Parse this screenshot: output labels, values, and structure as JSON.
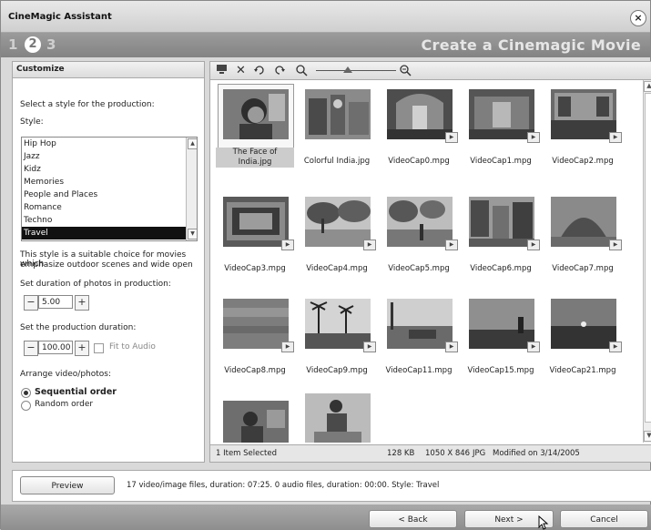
{
  "window": {
    "title": "CineMagic Assistant",
    "close_glyph": "×"
  },
  "steps": {
    "items": [
      "1",
      "2",
      "3"
    ],
    "active": "2",
    "heading": "Create a Cinemagic Movie"
  },
  "customize": {
    "header": "Customize",
    "select_prompt": "Select a style for the production:",
    "style_label": "Style:",
    "styles": [
      "Hip Hop",
      "Jazz",
      "Kidz",
      "Memories",
      "People and Places",
      "Romance",
      "Techno",
      "Travel"
    ],
    "selected_style": "Travel",
    "description_line1": "This style is a suitable choice for movies which",
    "description_line2": "emphasize outdoor scenes and wide open",
    "photo_duration_label": "Set duration of photos in production:",
    "photo_duration_value": "5.00",
    "production_duration_label": "Set the production duration:",
    "production_duration_value": "100.00",
    "fit_to_audio_label": "Fit to Audio",
    "arrange_label": "Arrange video/photos:",
    "sequential_label": "Sequential order",
    "random_label": "Random order",
    "minus": "−",
    "plus": "+"
  },
  "toolbar": {
    "icons": [
      "monitor-icon",
      "delete-icon",
      "rotate-left-icon",
      "rotate-right-icon",
      "zoom-out-icon",
      "zoom-in-icon"
    ]
  },
  "media": {
    "items": [
      {
        "name": "The Face of India.jpg",
        "line1": "The Face of",
        "line2": "India.jpg",
        "type": "photo",
        "selected": true
      },
      {
        "name": "Colorful India.jpg",
        "type": "photo"
      },
      {
        "name": "VideoCap0.mpg",
        "type": "video"
      },
      {
        "name": "VideoCap1.mpg",
        "type": "video"
      },
      {
        "name": "VideoCap2.mpg",
        "type": "video"
      },
      {
        "name": "VideoCap3.mpg",
        "type": "video"
      },
      {
        "name": "VideoCap4.mpg",
        "type": "video"
      },
      {
        "name": "VideoCap5.mpg",
        "type": "video"
      },
      {
        "name": "VideoCap6.mpg",
        "type": "video"
      },
      {
        "name": "VideoCap7.mpg",
        "type": "video"
      },
      {
        "name": "VideoCap8.mpg",
        "type": "video"
      },
      {
        "name": "VideoCap9.mpg",
        "type": "video"
      },
      {
        "name": "VideoCap11.mpg",
        "type": "video"
      },
      {
        "name": "VideoCap15.mpg",
        "type": "video"
      },
      {
        "name": "VideoCap21.mpg",
        "type": "video"
      },
      {
        "name": "",
        "type": "video"
      },
      {
        "name": "",
        "type": "photo"
      }
    ]
  },
  "status": {
    "selected": "1 Item Selected",
    "size": "128 KB",
    "dims": "1050 X 846",
    "format": "JPG",
    "modified": "Modified on 3/14/2005"
  },
  "summary": {
    "preview_label": "Preview",
    "text": "17 video/image files, duration: 07:25.  0 audio files, duration: 00:00.  Style: Travel"
  },
  "nav": {
    "back": "< Back",
    "next": "Next >",
    "cancel": "Cancel"
  }
}
